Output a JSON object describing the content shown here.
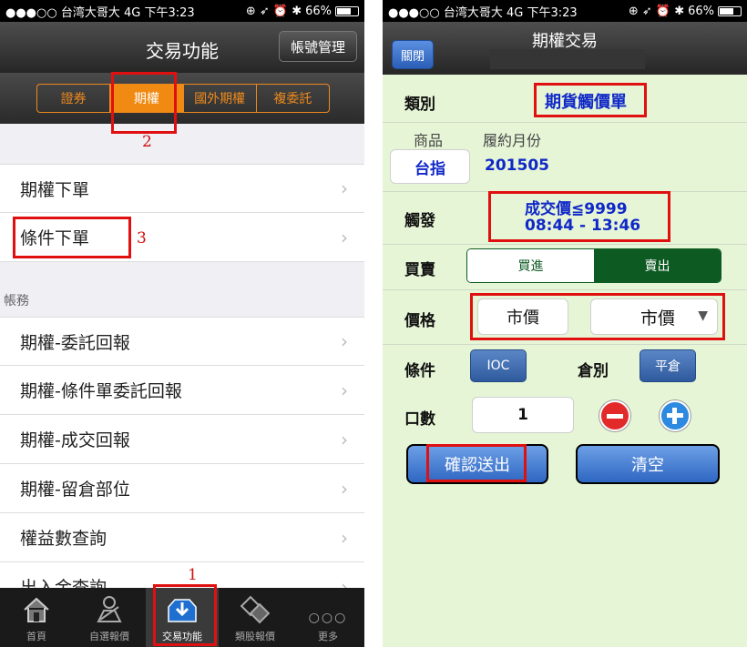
{
  "status": {
    "carrier": "●●●○○ 台湾大哥大  4G  下午3:23",
    "icons": "⊕ ➶ ⏰ ✱",
    "battery": "66%"
  },
  "left": {
    "title": "交易功能",
    "account_button": "帳號管理",
    "segments": [
      "證券",
      "期權",
      "國外期權",
      "複委託"
    ],
    "active_segment": 1,
    "items": [
      "期權下單",
      "條件下單"
    ],
    "section_label": "帳務",
    "account_items": [
      "期權-委託回報",
      "期權-條件單委託回報",
      "期權-成交回報",
      "期權-留倉部位",
      "權益數查詢",
      "出入金查詢"
    ],
    "tabs": [
      {
        "label": "首頁",
        "icon": "home-icon"
      },
      {
        "label": "自選報價",
        "icon": "watchlist-icon"
      },
      {
        "label": "交易功能",
        "icon": "trade-tray-icon"
      },
      {
        "label": "類股報價",
        "icon": "sector-icon"
      },
      {
        "label": "更多",
        "icon": "more-icon"
      }
    ],
    "annotations": [
      "1",
      "2",
      "3"
    ]
  },
  "right": {
    "title": "期權交易",
    "close_button": "關閉",
    "category_label": "類別",
    "category_value": "期貨觸價單",
    "product_label": "商品",
    "month_label": "履約月份",
    "product_value": "台指",
    "month_value": "201505",
    "trigger_label": "觸發",
    "trigger_price": "成交價≦9999",
    "trigger_time": "08:44 - 13:46",
    "side_label": "買賣",
    "buy": "買進",
    "sell": "賣出",
    "price_label": "價格",
    "price_type": "市價",
    "price_select": "市價",
    "condition_label": "條件",
    "condition_value": "IOC",
    "position_label": "倉別",
    "position_value": "平倉",
    "qty_label": "口數",
    "qty_value": "1",
    "confirm": "確認送出",
    "clear": "清空",
    "colors": {
      "sell_active": "#0d5a22",
      "minus": "#e22a2a",
      "plus": "#2d8ae0"
    }
  }
}
